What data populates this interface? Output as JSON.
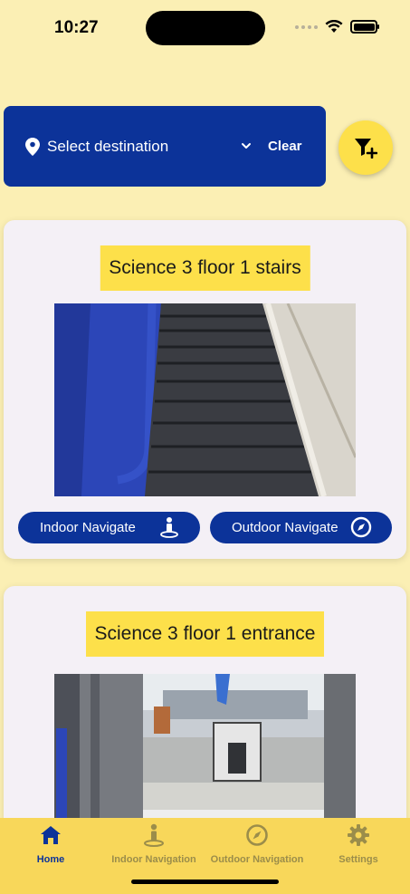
{
  "status_bar": {
    "time": "10:27"
  },
  "destination": {
    "label": "Select destination",
    "clear_label": "Clear"
  },
  "cards": [
    {
      "title": "Science 3 floor 1 stairs",
      "indoor_label": "Indoor Navigate",
      "outdoor_label": "Outdoor Navigate"
    },
    {
      "title": "Science 3 floor 1 entrance"
    }
  ],
  "tabs": [
    {
      "label": "Home",
      "icon": "home-icon",
      "active": true
    },
    {
      "label": "Indoor Navigation",
      "icon": "person-pin-icon",
      "active": false
    },
    {
      "label": "Outdoor Navigation",
      "icon": "compass-icon",
      "active": false
    },
    {
      "label": "Settings",
      "icon": "gear-icon",
      "active": false
    }
  ],
  "colors": {
    "background": "#fbefb4",
    "primary_blue": "#0c3399",
    "accent_yellow": "#fde04a",
    "tab_bar": "#f8d75a"
  }
}
